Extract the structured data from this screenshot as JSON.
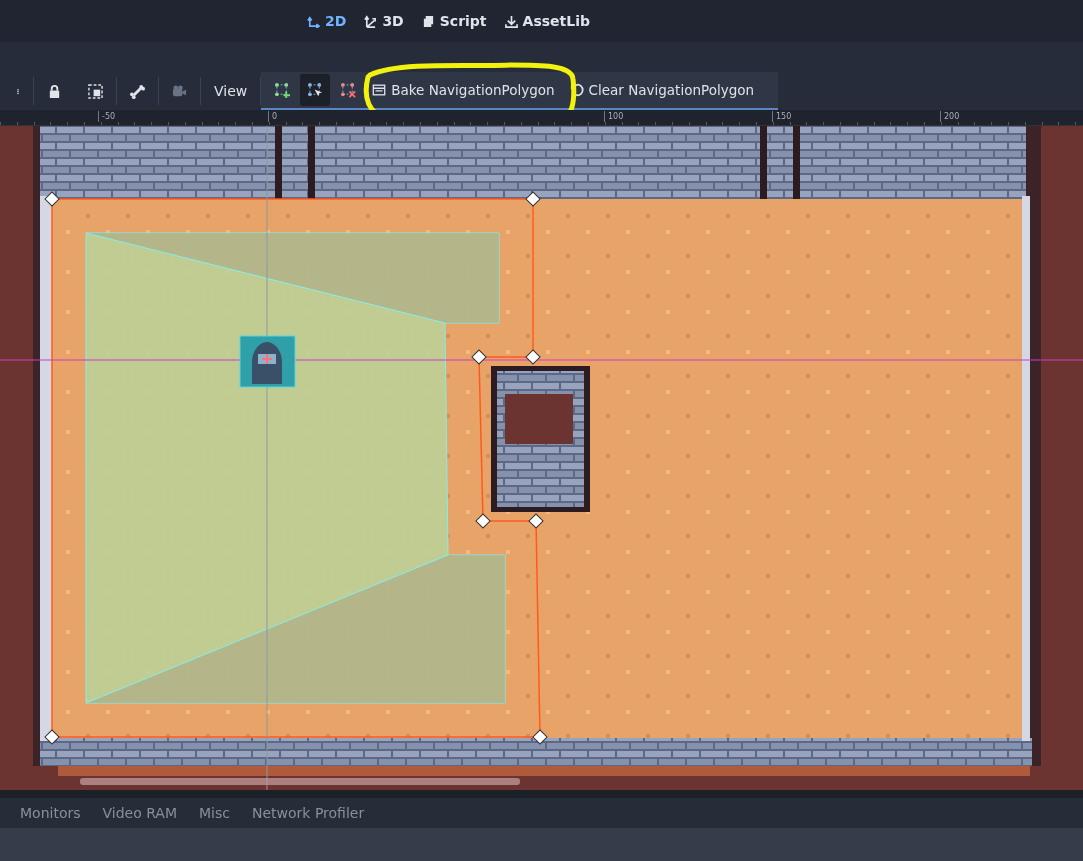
{
  "workspace_tabs": [
    {
      "label": "2D",
      "selected": true
    },
    {
      "label": "3D",
      "selected": false
    },
    {
      "label": "Script",
      "selected": false
    },
    {
      "label": "AssetLib",
      "selected": false
    }
  ],
  "toolbar": {
    "view_menu": "View",
    "polygon_tools": [
      {
        "kind": "add",
        "selected": false
      },
      {
        "kind": "edit",
        "selected": true
      },
      {
        "kind": "delete",
        "selected": false
      }
    ],
    "bake_button": "Bake NavigationPolygon",
    "clear_button": "Clear NavigationPolygon"
  },
  "ruler": {
    "labels": [
      "-50",
      "0",
      "100",
      "150",
      "200"
    ]
  },
  "bottom_tabs": [
    "Monitors",
    "Video RAM",
    "Misc",
    "Network Profiler"
  ]
}
